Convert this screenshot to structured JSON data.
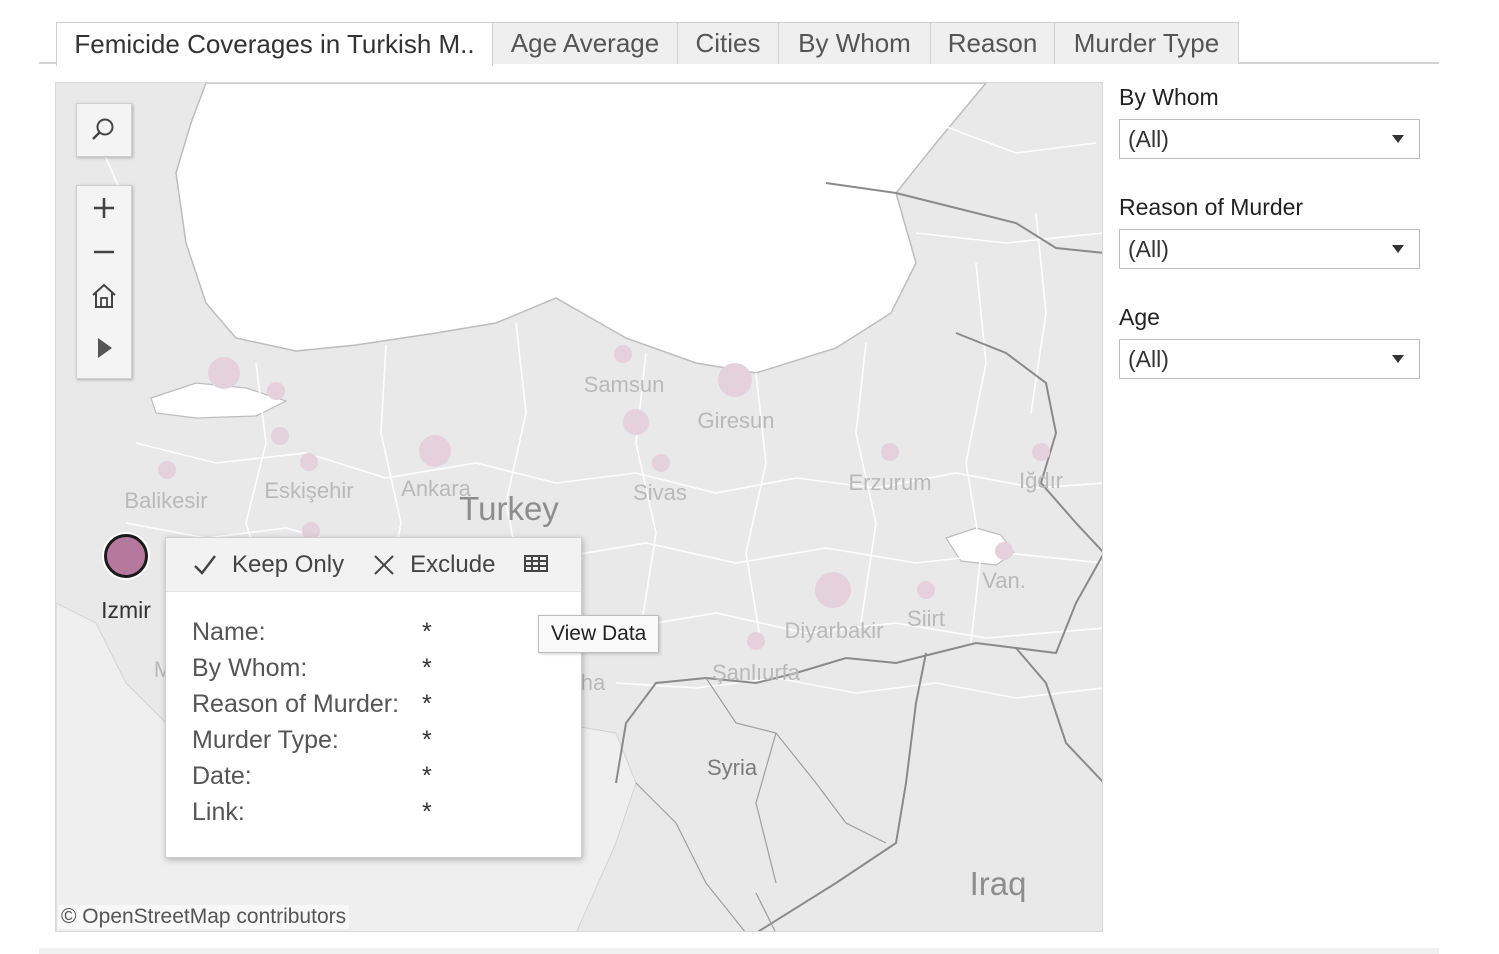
{
  "tabs": [
    {
      "label": "Femicide Coverages in Turkish M..",
      "active": true
    },
    {
      "label": "Age Average"
    },
    {
      "label": "Cities"
    },
    {
      "label": "By Whom"
    },
    {
      "label": "Reason"
    },
    {
      "label": "Murder Type"
    }
  ],
  "map": {
    "labels": {
      "country": "Turkey",
      "samsun": "Samsun",
      "giresun": "Giresun",
      "balikesir": "Balikesir",
      "eskisehir": "Eskişehir",
      "ankara": "Ankara",
      "sivas": "Sivas",
      "erzurum": "Erzurum",
      "igdir": "Iğdır",
      "van": "Van.",
      "siirt": "Siirt",
      "diyarbakir": "Diyarbakir",
      "sanliurfa": "Şanlıurfa",
      "syria": "Syria",
      "iraq": "Iraq",
      "partial_m": "M",
      "partial_ha": "ha"
    },
    "selected_city": "Izmir",
    "attribution": "© OpenStreetMap contributors",
    "accent_color": "#b5799d",
    "dot_color": "#e4d1db"
  },
  "tooltip": {
    "keep_only": "Keep Only",
    "exclude": "Exclude",
    "view_data_hint": "View Data",
    "rows": [
      {
        "label": "Name:",
        "value": "*"
      },
      {
        "label": "By Whom:",
        "value": "*"
      },
      {
        "label": "Reason of Murder:",
        "value": "*"
      },
      {
        "label": "Murder Type:",
        "value": "*"
      },
      {
        "label": "Date:",
        "value": "*"
      },
      {
        "label": "Link:",
        "value": "*"
      }
    ]
  },
  "filters": [
    {
      "title": "By Whom",
      "value": "(All)"
    },
    {
      "title": "Reason of Murder",
      "value": "(All)"
    },
    {
      "title": "Age",
      "value": "(All)"
    }
  ]
}
